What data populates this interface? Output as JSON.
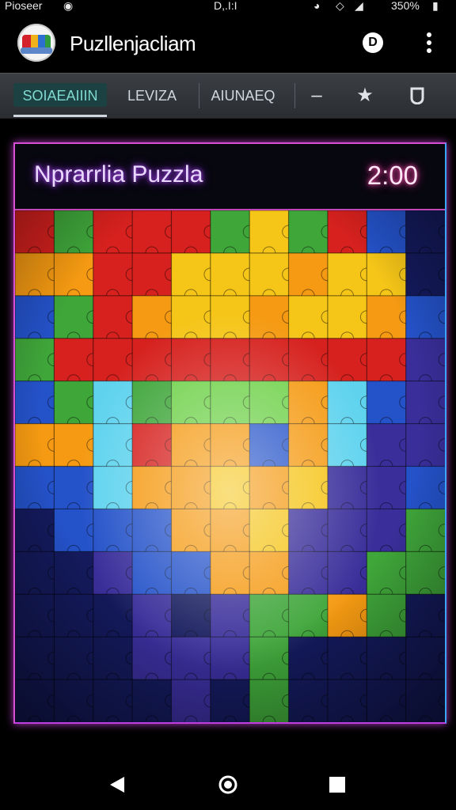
{
  "status_bar": {
    "left": "Pioseer",
    "center": "D,.I:I",
    "battery": "350%"
  },
  "app_bar": {
    "title": "Puzllenjacliam",
    "coin_icon": "coin-icon",
    "coin_glyph": "D",
    "more_icon": "more-vert-icon"
  },
  "tabs": [
    {
      "label": "SOIAEAIIIN",
      "active": true
    },
    {
      "label": "LEVIZA",
      "active": false
    },
    {
      "label": "AIUNAEQ",
      "active": false
    }
  ],
  "tab_icons": [
    "minus-icon",
    "star-icon",
    "shield-icon"
  ],
  "puzzle": {
    "title": "Nprarrlia Puzzla",
    "timer": "2:00"
  },
  "board": {
    "colors": {
      "red": "#d6211e",
      "orange": "#f59a12",
      "yellow": "#f5c518",
      "green": "#3fa63a",
      "lime": "#6fd14a",
      "cyan": "#5fd3ee",
      "blue": "#2452c9",
      "purple": "#3a2e9a",
      "navy": "#141a5c",
      "dark": "#0b0f2e"
    },
    "rows": [
      "RGRRRGYGRBN",
      "OORRYYYOYYN",
      "BGROYYOYYOB",
      "GRRRRRRRRRP",
      "BGCGLLLOCBP",
      "OOCROOBOCPP",
      "BBCOOYOYPPB",
      "NBBBOOYPPPG",
      "NNPBBOOPPGG",
      "NNNPNPGGOGN",
      "NNNPPPGNNNN",
      "NNNNPNGNNNN"
    ]
  },
  "nav_bar": {
    "back_icon": "back-triangle-icon",
    "home_icon": "home-circle-icon",
    "recents_icon": "recents-square-icon"
  }
}
